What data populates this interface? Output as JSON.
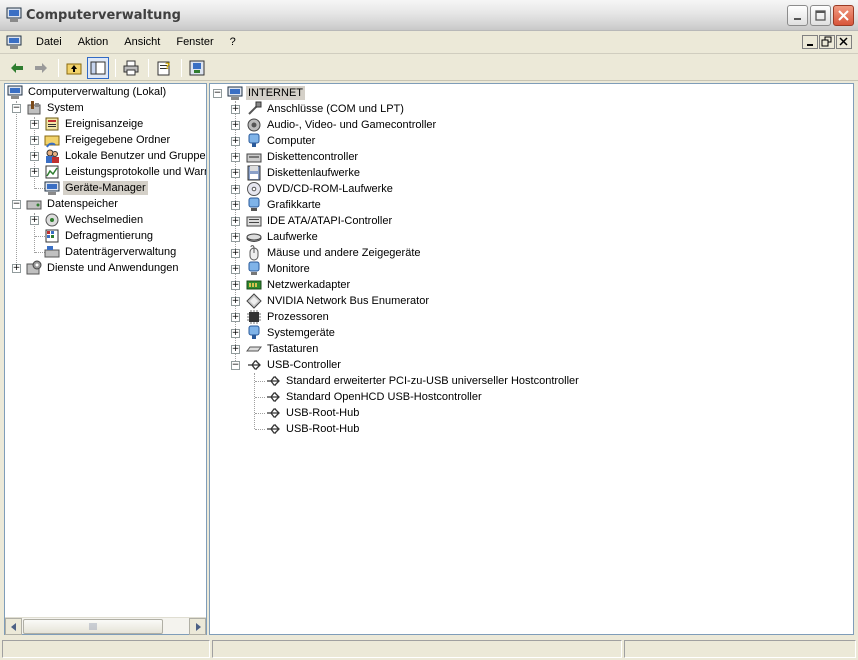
{
  "window": {
    "title": "Computerverwaltung",
    "app_icon": "computer-management-icon"
  },
  "menubar": {
    "items": [
      {
        "label": "Datei"
      },
      {
        "label": "Aktion"
      },
      {
        "label": "Ansicht"
      },
      {
        "label": "Fenster"
      },
      {
        "label": "?"
      }
    ]
  },
  "toolbar": {
    "buttons": [
      "back-arrow-icon",
      "forward-arrow-icon",
      "up-folder-icon",
      "show-hide-tree-icon",
      "print-icon",
      "properties-help-icon",
      "device-manager-icon"
    ]
  },
  "left_tree": {
    "root": "Computerverwaltung (Lokal)",
    "items": [
      {
        "label": "System",
        "icon": "system-tools-icon"
      },
      {
        "label": "Ereignisanzeige",
        "icon": "event-viewer-icon"
      },
      {
        "label": "Freigegebene Ordner",
        "icon": "shared-folders-icon"
      },
      {
        "label": "Lokale Benutzer und Gruppen",
        "icon": "users-icon"
      },
      {
        "label": "Leistungsprotokolle und Warn",
        "icon": "performance-logs-icon"
      },
      {
        "label": "Geräte-Manager",
        "icon": "device-manager-icon"
      },
      {
        "label": "Datenspeicher",
        "icon": "storage-icon"
      },
      {
        "label": "Wechselmedien",
        "icon": "removable-storage-icon"
      },
      {
        "label": "Defragmentierung",
        "icon": "defrag-icon"
      },
      {
        "label": "Datenträgerverwaltung",
        "icon": "disk-management-icon"
      },
      {
        "label": "Dienste und Anwendungen",
        "icon": "services-icon"
      }
    ]
  },
  "device_tree": {
    "root": "INTERNET",
    "categories": [
      {
        "label": "Anschlüsse (COM und LPT)",
        "icon": "port-icon"
      },
      {
        "label": "Audio-, Video- und Gamecontroller",
        "icon": "audio-icon"
      },
      {
        "label": "Computer",
        "icon": "computer-icon"
      },
      {
        "label": "Diskettencontroller",
        "icon": "floppy-controller-icon"
      },
      {
        "label": "Diskettenlaufwerke",
        "icon": "floppy-drive-icon"
      },
      {
        "label": "DVD/CD-ROM-Laufwerke",
        "icon": "cdrom-icon"
      },
      {
        "label": "Grafikkarte",
        "icon": "display-adapter-icon"
      },
      {
        "label": "IDE ATA/ATAPI-Controller",
        "icon": "ide-controller-icon"
      },
      {
        "label": "Laufwerke",
        "icon": "disk-drive-icon"
      },
      {
        "label": "Mäuse und andere Zeigegeräte",
        "icon": "mouse-icon"
      },
      {
        "label": "Monitore",
        "icon": "monitor-icon"
      },
      {
        "label": "Netzwerkadapter",
        "icon": "network-adapter-icon"
      },
      {
        "label": "NVIDIA Network Bus Enumerator",
        "icon": "nvidia-bus-icon"
      },
      {
        "label": "Prozessoren",
        "icon": "processor-icon"
      },
      {
        "label": "Systemgeräte",
        "icon": "system-devices-icon"
      },
      {
        "label": "Tastaturen",
        "icon": "keyboard-icon"
      },
      {
        "label": "USB-Controller",
        "icon": "usb-controller-icon"
      }
    ],
    "usb_children": [
      {
        "label": "Standard erweiterter PCI-zu-USB universeller Hostcontroller"
      },
      {
        "label": "Standard OpenHCD USB-Hostcontroller"
      },
      {
        "label": "USB-Root-Hub"
      },
      {
        "label": "USB-Root-Hub"
      }
    ]
  }
}
